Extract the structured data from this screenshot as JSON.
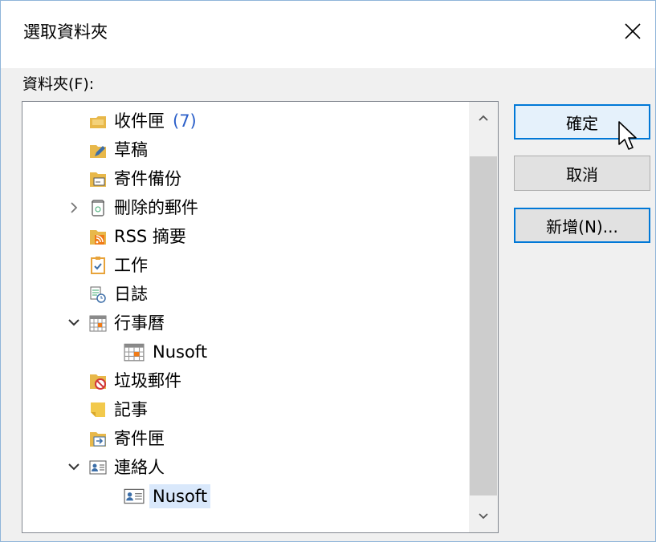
{
  "dialog": {
    "title": "選取資料夾",
    "folder_label": "資料夾(F):"
  },
  "tree": {
    "items": [
      {
        "label": "收件匣",
        "count": "(7)",
        "icon": "inbox-icon"
      },
      {
        "label": "草稿",
        "icon": "drafts-icon"
      },
      {
        "label": "寄件備份",
        "icon": "sent-items-icon"
      },
      {
        "label": "刪除的郵件",
        "icon": "deleted-items-icon",
        "expander": "collapsed"
      },
      {
        "label": "RSS 摘要",
        "icon": "rss-feed-icon"
      },
      {
        "label": "工作",
        "icon": "tasks-icon"
      },
      {
        "label": "日誌",
        "icon": "journal-icon"
      },
      {
        "label": "行事曆",
        "icon": "calendar-icon",
        "expander": "expanded"
      },
      {
        "label": "Nusoft",
        "icon": "calendar-icon"
      },
      {
        "label": "垃圾郵件",
        "icon": "junk-mail-icon"
      },
      {
        "label": "記事",
        "icon": "notes-icon"
      },
      {
        "label": "寄件匣",
        "icon": "outbox-icon"
      },
      {
        "label": "連絡人",
        "icon": "contacts-icon",
        "expander": "expanded"
      },
      {
        "label": "Nusoft",
        "icon": "contacts-icon",
        "selected": true
      }
    ]
  },
  "buttons": {
    "ok": "確定",
    "cancel": "取消",
    "new": "新增(N)..."
  },
  "colors": {
    "accent": "#0078d7",
    "count": "#2b5fc9",
    "selection": "#d9e8fb",
    "folder": "#e8b84a"
  }
}
